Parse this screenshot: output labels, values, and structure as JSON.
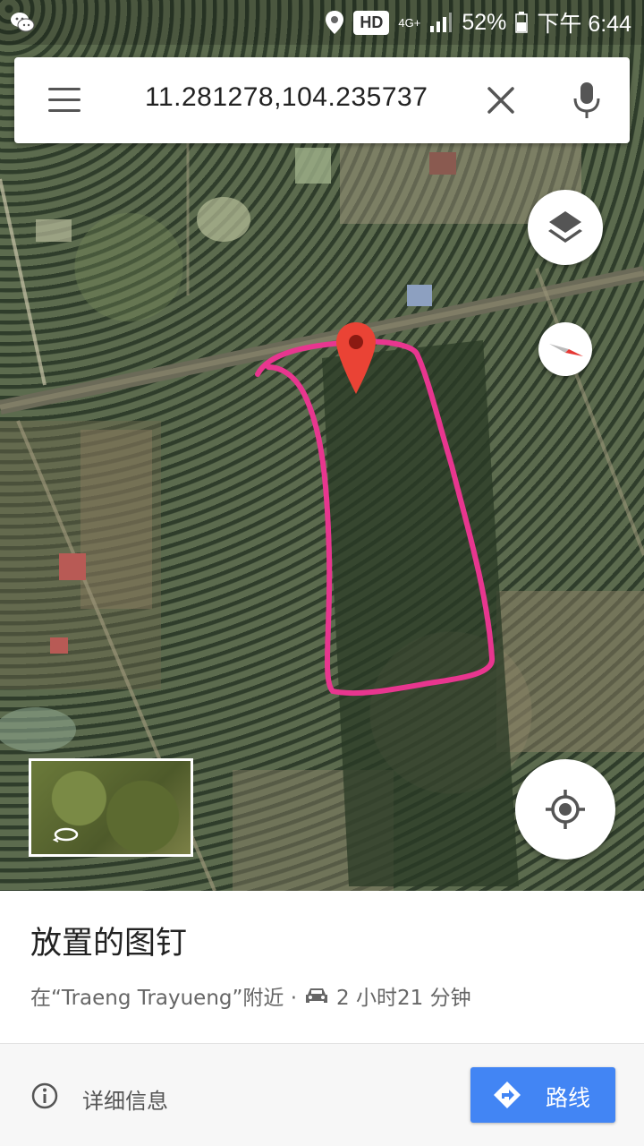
{
  "status": {
    "hd": "HD",
    "network": "4G+",
    "battery": "52%",
    "time": "下午 6:44"
  },
  "search": {
    "query": "11.281278,104.235737"
  },
  "place": {
    "title": "放置的图钉",
    "nearby": "在“Traeng Trayueng”附近 ·",
    "drive_time": "2 小时21 分钟"
  },
  "footer": {
    "details_label": "详细信息",
    "route_label": "路线"
  },
  "colors": {
    "accent": "#4285f4",
    "pin": "#ea4335",
    "annotation": "#e8368f"
  },
  "icons": [
    "wechat-icon",
    "location-icon",
    "signal-icon",
    "battery-icon",
    "menu-icon",
    "close-icon",
    "mic-icon",
    "layers-icon",
    "compass-icon",
    "my-location-icon",
    "rotate-icon",
    "car-icon",
    "info-icon",
    "directions-icon",
    "map-pin-icon"
  ]
}
